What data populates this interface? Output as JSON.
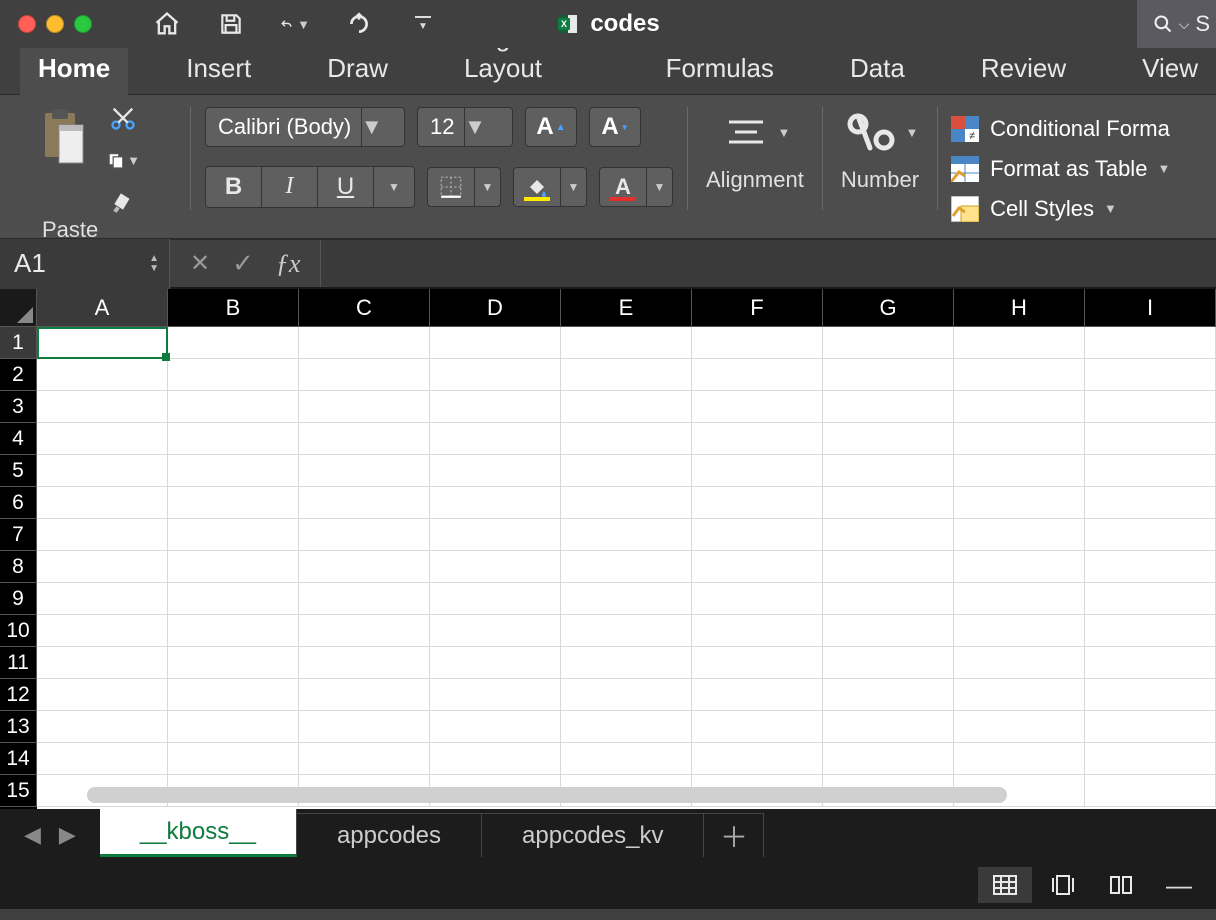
{
  "title": "codes",
  "search_hint": "S",
  "ribbon_tabs": [
    "Home",
    "Insert",
    "Draw",
    "Page Layout",
    "Formulas",
    "Data",
    "Review",
    "View"
  ],
  "active_tab": 0,
  "paste_label": "Paste",
  "font_name": "Calibri (Body)",
  "font_size": "12",
  "alignment_label": "Alignment",
  "number_label": "Number",
  "styles": {
    "cond": "Conditional Forma",
    "table": "Format as Table",
    "cells": "Cell Styles"
  },
  "namebox": "A1",
  "formula_value": "",
  "columns": [
    "A",
    "B",
    "C",
    "D",
    "E",
    "F",
    "G",
    "H",
    "I"
  ],
  "rows": [
    "1",
    "2",
    "3",
    "4",
    "5",
    "6",
    "7",
    "8",
    "9",
    "10",
    "11",
    "12",
    "13",
    "14",
    "15"
  ],
  "selected_cell": "A1",
  "sheets": [
    "__kboss__",
    "appcodes",
    "appcodes_kv"
  ],
  "active_sheet": 0
}
